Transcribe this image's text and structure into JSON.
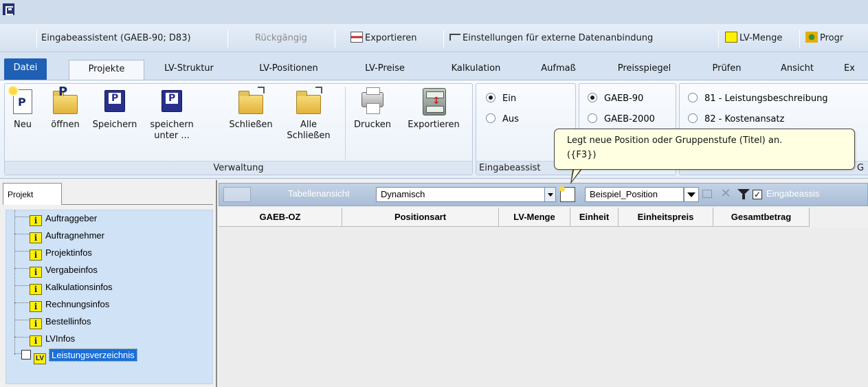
{
  "quick_access": {
    "items": [
      {
        "label": "Eingabeassistent (GAEB-90; D83)"
      },
      {
        "label": "Rückgängig"
      },
      {
        "label": "Exportieren"
      },
      {
        "label": "Einstellungen für externe Datenanbindung"
      },
      {
        "label": "LV-Menge"
      },
      {
        "label": "Progr"
      }
    ]
  },
  "tabs": [
    {
      "label": "Datei"
    },
    {
      "label": "Projekte"
    },
    {
      "label": "LV-Struktur"
    },
    {
      "label": "LV-Positionen"
    },
    {
      "label": "LV-Preise"
    },
    {
      "label": "Kalkulation"
    },
    {
      "label": "Aufmaß"
    },
    {
      "label": "Preisspiegel"
    },
    {
      "label": "Prüfen"
    },
    {
      "label": "Ansicht"
    },
    {
      "label": "Ex"
    }
  ],
  "ribbon": {
    "verwaltung": {
      "label": "Verwaltung",
      "buttons": [
        {
          "label": "Neu"
        },
        {
          "label": "öffnen"
        },
        {
          "label": "Speichern"
        },
        {
          "label": "speichern unter ..."
        },
        {
          "label": "Schließen"
        },
        {
          "label": "Alle Schließen"
        },
        {
          "label": "Drucken"
        },
        {
          "label": "Exportieren"
        }
      ]
    },
    "eingabe": {
      "label": "Eingabeassist",
      "options": [
        {
          "label": "Ein",
          "checked": true
        },
        {
          "label": "Aus",
          "checked": false
        }
      ]
    },
    "format": {
      "options": [
        {
          "label": "GAEB-90",
          "checked": true
        },
        {
          "label": "GAEB-2000",
          "checked": false
        }
      ]
    },
    "phase": {
      "options": [
        {
          "label": "81 - Leistungsbeschreibung",
          "checked": false
        },
        {
          "label": "82 - Kostenansatz",
          "checked": false
        }
      ],
      "clipped_label": "G"
    }
  },
  "tooltip": {
    "line1": "Legt neue Position oder Gruppenstufe (Titel) an.",
    "line2": "({F3})"
  },
  "left_panel": {
    "tab": "Projekt",
    "tree": [
      {
        "label": "Auftraggeber"
      },
      {
        "label": "Auftragnehmer"
      },
      {
        "label": "Projektinfos"
      },
      {
        "label": "Vergabeinfos"
      },
      {
        "label": "Kalkulationsinfos"
      },
      {
        "label": "Rechnungsinfos"
      },
      {
        "label": "Bestellinfos"
      },
      {
        "label": "LVInfos"
      }
    ],
    "selected": {
      "label": "Leistungsverzeichnis",
      "icon_text": "LV"
    }
  },
  "toolbar": {
    "view_label": "Tabellenansicht",
    "view_value": "Dynamisch",
    "template_value": "Beispiel_Position",
    "checkbox_label": "Eingabeassis",
    "checkbox_checked": true
  },
  "table": {
    "columns": [
      {
        "label": "GAEB-OZ"
      },
      {
        "label": "Positionsart"
      },
      {
        "label": "LV-Menge"
      },
      {
        "label": "Einheit"
      },
      {
        "label": "Einheitspreis"
      },
      {
        "label": "Gesamtbetrag"
      }
    ],
    "rows": []
  },
  "colors": {
    "file_tab": "#1f5fb4",
    "selection": "#1a6fd8",
    "tooltip_bg": "#ffffe1",
    "tree_bg": "#cfe2f6"
  }
}
